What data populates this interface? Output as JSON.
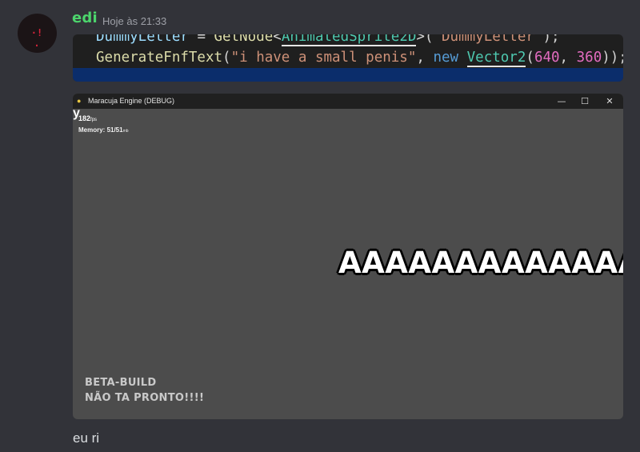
{
  "message_header": {
    "username": "edi",
    "timestamp": "Hoje às 21:33",
    "avatar_icon": "avatar-red-face-icon"
  },
  "code_image": {
    "line1": {
      "var": "DummyLetter",
      "op": " = ",
      "fn": "GetNode",
      "lt": "<",
      "type": "AnimatedSprite2D",
      "gt": ">(",
      "str": "\"DummyLetter\"",
      "end": ");"
    },
    "line2": {
      "fn": "GenerateFnfText",
      "open": "(",
      "str": "\"i have a small penis\"",
      "comma": ", ",
      "kw": "new",
      "space": " ",
      "type": "Vector2",
      "paren": "(",
      "n1": "640",
      "sep": ", ",
      "n2": "360",
      "end": "));"
    }
  },
  "game_window": {
    "title": "Maracuja Engine (DEBUG)",
    "icon": "maracuja-icon",
    "controls": {
      "minimize": "—",
      "maximize": "☐",
      "close": "✕"
    },
    "fps_value": "182",
    "fps_unit": "fps",
    "memory_label": "Memory: 51/51",
    "memory_unit": "mb",
    "corner_glyph": "y",
    "big_text": "AAAAAAAAAAAAAA",
    "beta_line1": "BETA-BUILD",
    "beta_line2": "NÃO TA PRONTO!!!!"
  },
  "message_text": "eu ri"
}
